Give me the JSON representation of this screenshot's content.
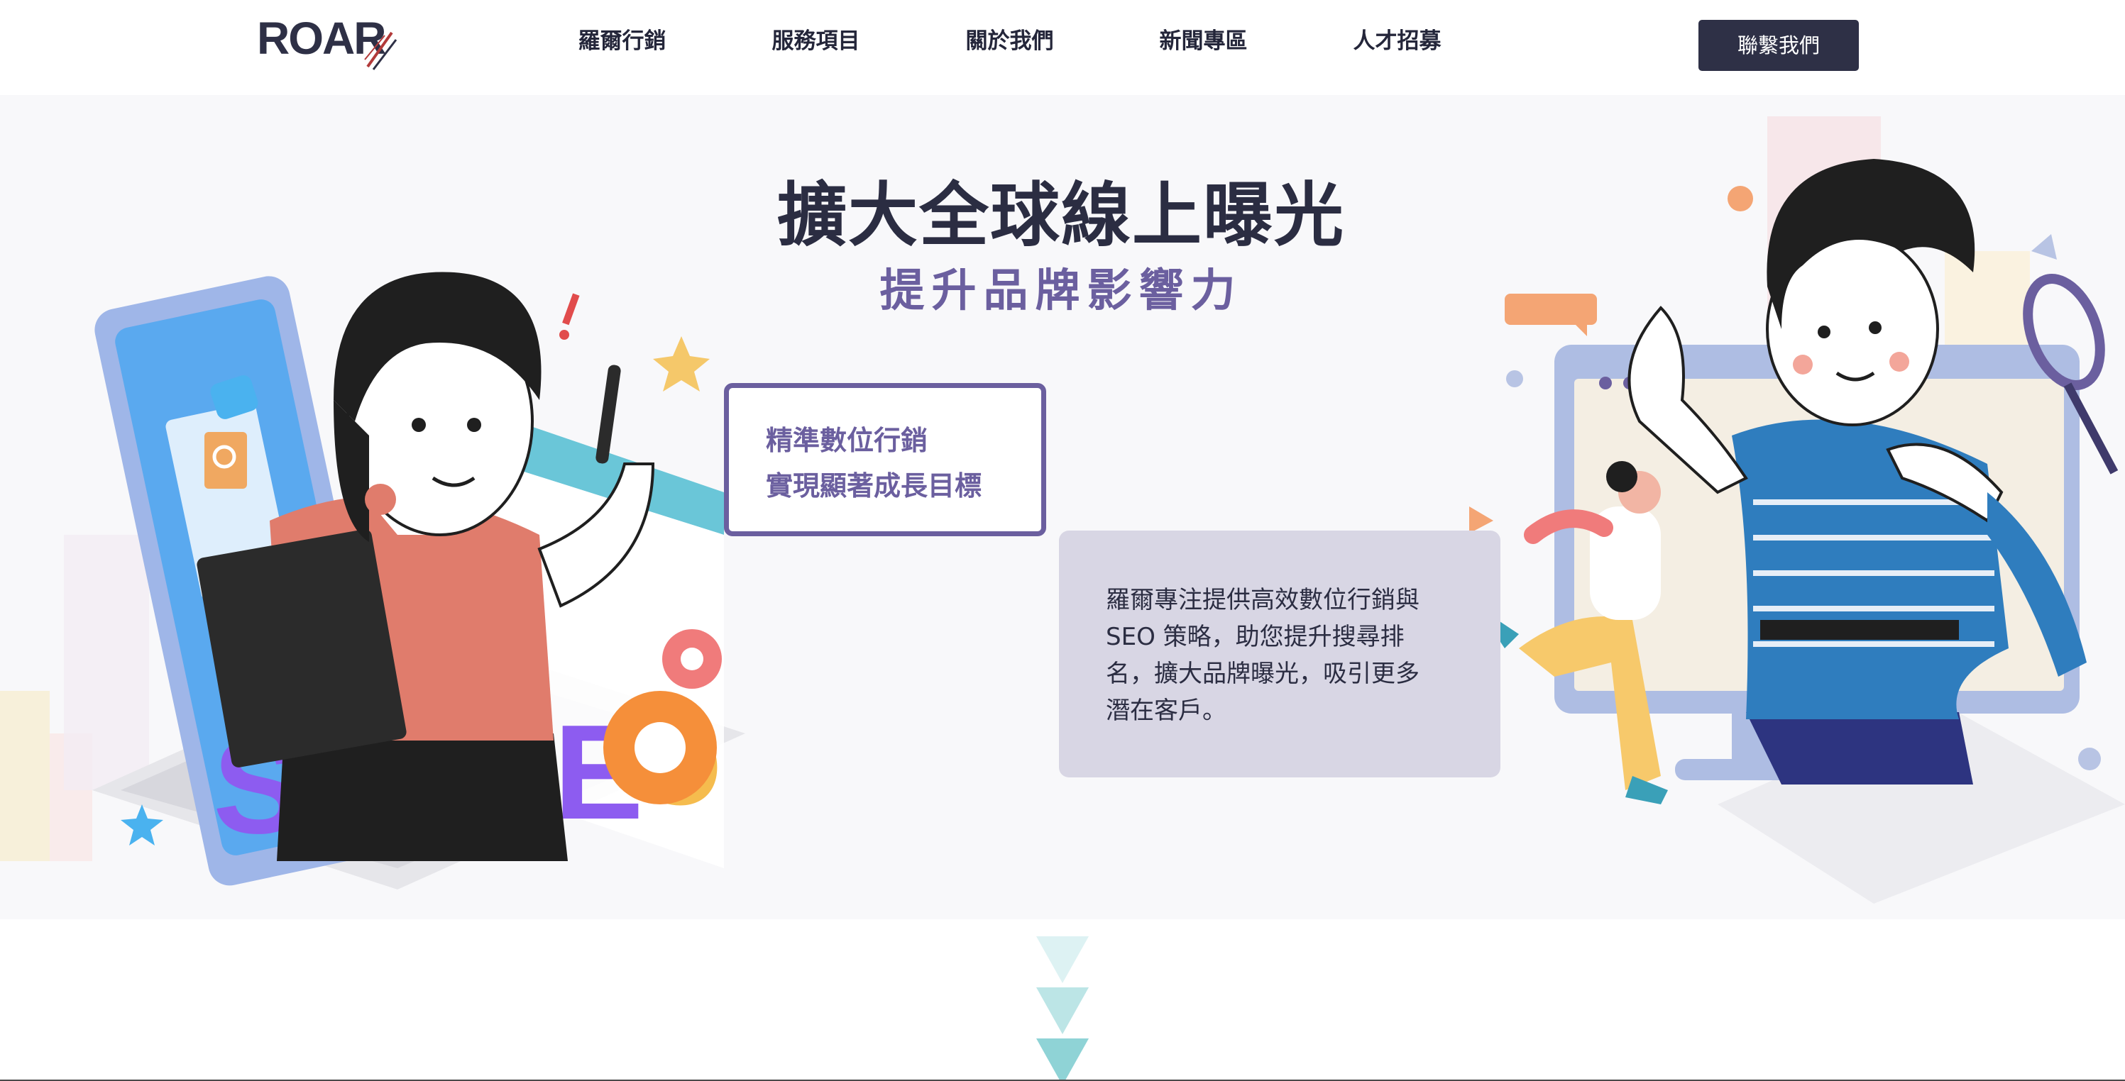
{
  "header": {
    "logo_text": "ROAR",
    "nav": [
      "羅爾行銷",
      "服務項目",
      "關於我們",
      "新聞專區",
      "人才招募"
    ],
    "contact_label": "聯繫我們"
  },
  "hero": {
    "title": "擴大全球線上曝光",
    "subtitle": "提升品牌影響力",
    "highlight_lines": [
      "精準數位行銷",
      "實現顯著成長目標"
    ],
    "desc_lines": [
      "羅爾專注提供高效數位行銷與",
      "SEO 策略，助您提升搜尋排",
      "名，擴大品牌曝光，吸引更多",
      "潛在客戶。"
    ]
  },
  "illustration_left": {
    "letters": [
      "S",
      "E",
      "O"
    ]
  },
  "colors": {
    "brand_dark": "#2e3046",
    "accent_purple": "#6b5f9f",
    "panel_lilac": "#d8d6e4",
    "hero_bg": "#f8f8fa",
    "arrow_teal": "#8fd3d6"
  },
  "icons": {
    "logo_mark": "claw-scratch-icon",
    "scroll": "scroll-down-arrows-icon"
  }
}
